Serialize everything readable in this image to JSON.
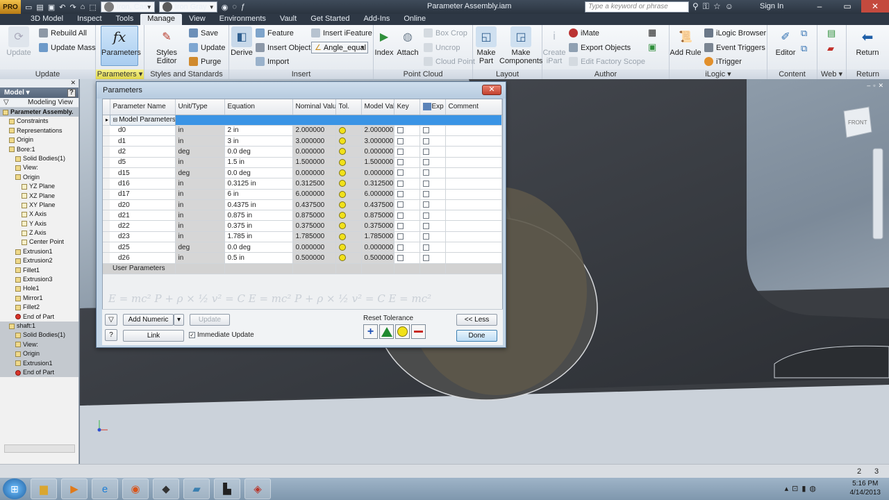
{
  "app": {
    "logo": "PRO",
    "doc_title": "Parameter Assembly.iam",
    "search_placeholder": "Type a keyword or phrase",
    "sign_in": "Sign In",
    "material": "Iron, Cast",
    "appearance": "Iron Gray"
  },
  "tabs": [
    "3D Model",
    "Inspect",
    "Tools",
    "Manage",
    "View",
    "Environments",
    "Vault",
    "Get Started",
    "Add-Ins",
    "Online"
  ],
  "ribbon": {
    "update": {
      "label": "Update",
      "rebuild_all": "Rebuild All",
      "update_mass": "Update Mass",
      "panel": "Update"
    },
    "parameters": {
      "label": "Parameters",
      "panel": "Parameters"
    },
    "styles": {
      "styles_editor": "Styles Editor",
      "save": "Save",
      "update": "Update",
      "purge": "Purge",
      "panel": "Styles and Standards"
    },
    "insert": {
      "derive": "Derive",
      "feature": "Feature",
      "insert_object": "Insert Object",
      "import": "Import",
      "insert_ifeature": "Insert iFeature",
      "angle_equal": "Angle_equal",
      "panel": "Insert"
    },
    "pointcloud": {
      "index": "Index",
      "attach": "Attach",
      "box_crop": "Box Crop",
      "uncrop": "Uncrop",
      "cloud_point": "Cloud Point",
      "panel": "Point Cloud"
    },
    "layout": {
      "make_part": "Make Part",
      "make_components": "Make Components",
      "panel": "Layout"
    },
    "author": {
      "create_ipart": "Create iPart",
      "imate": "iMate",
      "export_objects": "Export Objects",
      "edit_factory_scope": "Edit Factory Scope",
      "panel": "Author"
    },
    "ilogic": {
      "add_rule": "Add Rule",
      "ilogic_browser": "iLogic Browser",
      "event_triggers": "Event Triggers",
      "itrigger": "iTrigger",
      "panel": "iLogic"
    },
    "content": {
      "editor": "Editor",
      "panel": "Content Center"
    },
    "web": {
      "panel": "Web"
    },
    "return": {
      "label": "Return",
      "panel": "Return"
    }
  },
  "browser": {
    "title": "Model",
    "filter_label": "Modeling View",
    "items": [
      {
        "label": "Parameter Assembly.",
        "level": 0,
        "bold": true
      },
      {
        "label": "Constraints",
        "level": 1
      },
      {
        "label": "Representations",
        "level": 1
      },
      {
        "label": "Origin",
        "level": 1
      },
      {
        "label": "Bore:1",
        "level": 1
      },
      {
        "label": "Solid Bodies(1)",
        "level": 2
      },
      {
        "label": "View:",
        "level": 2
      },
      {
        "label": "Origin",
        "level": 2
      },
      {
        "label": "YZ Plane",
        "level": 3
      },
      {
        "label": "XZ Plane",
        "level": 3
      },
      {
        "label": "XY Plane",
        "level": 3
      },
      {
        "label": "X Axis",
        "level": 3
      },
      {
        "label": "Y Axis",
        "level": 3
      },
      {
        "label": "Z Axis",
        "level": 3
      },
      {
        "label": "Center Point",
        "level": 3
      },
      {
        "label": "Extrusion1",
        "level": 2
      },
      {
        "label": "Extrusion2",
        "level": 2
      },
      {
        "label": "Fillet1",
        "level": 2
      },
      {
        "label": "Extrusion3",
        "level": 2
      },
      {
        "label": "Hole1",
        "level": 2
      },
      {
        "label": "Mirror1",
        "level": 2
      },
      {
        "label": "Fillet2",
        "level": 2
      },
      {
        "label": "End of Part",
        "level": 2
      },
      {
        "label": "shaft:1",
        "level": 1
      },
      {
        "label": "Solid Bodies(1)",
        "level": 2
      },
      {
        "label": "View:",
        "level": 2
      },
      {
        "label": "Origin",
        "level": 2
      },
      {
        "label": "Extrusion1",
        "level": 2
      },
      {
        "label": "End of Part",
        "level": 2
      }
    ]
  },
  "viewcube": {
    "face": "FRONT"
  },
  "dialog": {
    "title": "Parameters",
    "columns": [
      "Parameter Name",
      "Unit/Type",
      "Equation",
      "Nominal Value",
      "Tol.",
      "Model Value",
      "Key",
      "Exp",
      "Comment"
    ],
    "group_model": "Model Parameters",
    "group_user": "User Parameters",
    "rows": [
      {
        "name": "d0",
        "unit": "in",
        "eq": "2 in",
        "nom": "2.000000",
        "model": "2.000000"
      },
      {
        "name": "d1",
        "unit": "in",
        "eq": "3 in",
        "nom": "3.000000",
        "model": "3.000000"
      },
      {
        "name": "d2",
        "unit": "deg",
        "eq": "0.0 deg",
        "nom": "0.000000",
        "model": "0.000000"
      },
      {
        "name": "d5",
        "unit": "in",
        "eq": "1.5 in",
        "nom": "1.500000",
        "model": "1.500000"
      },
      {
        "name": "d15",
        "unit": "deg",
        "eq": "0.0 deg",
        "nom": "0.000000",
        "model": "0.000000"
      },
      {
        "name": "d16",
        "unit": "in",
        "eq": "0.3125 in",
        "nom": "0.312500",
        "model": "0.312500"
      },
      {
        "name": "d17",
        "unit": "in",
        "eq": "6 in",
        "nom": "6.000000",
        "model": "6.000000"
      },
      {
        "name": "d20",
        "unit": "in",
        "eq": "0.4375 in",
        "nom": "0.437500",
        "model": "0.437500"
      },
      {
        "name": "d21",
        "unit": "in",
        "eq": "0.875 in",
        "nom": "0.875000",
        "model": "0.875000"
      },
      {
        "name": "d22",
        "unit": "in",
        "eq": "0.375 in",
        "nom": "0.375000",
        "model": "0.375000"
      },
      {
        "name": "d23",
        "unit": "in",
        "eq": "1.785 in",
        "nom": "1.785000",
        "model": "1.785000"
      },
      {
        "name": "d25",
        "unit": "deg",
        "eq": "0.0 deg",
        "nom": "0.000000",
        "model": "0.000000"
      },
      {
        "name": "d26",
        "unit": "in",
        "eq": "0.5 in",
        "nom": "0.500000",
        "model": "0.500000"
      }
    ],
    "add_numeric": "Add Numeric",
    "update": "Update",
    "link": "Link",
    "immediate_update": "Immediate Update",
    "reset_tolerance": "Reset Tolerance",
    "less": "<< Less",
    "done": "Done",
    "formula_bg": "E = mc²   P + ρ × ½ v² = C   E = mc²   P + ρ × ½ v² = C   E = mc²"
  },
  "status": {
    "count1": "2",
    "count2": "3"
  },
  "taskbar": {
    "time": "5:16 PM",
    "date": "4/14/2013"
  }
}
